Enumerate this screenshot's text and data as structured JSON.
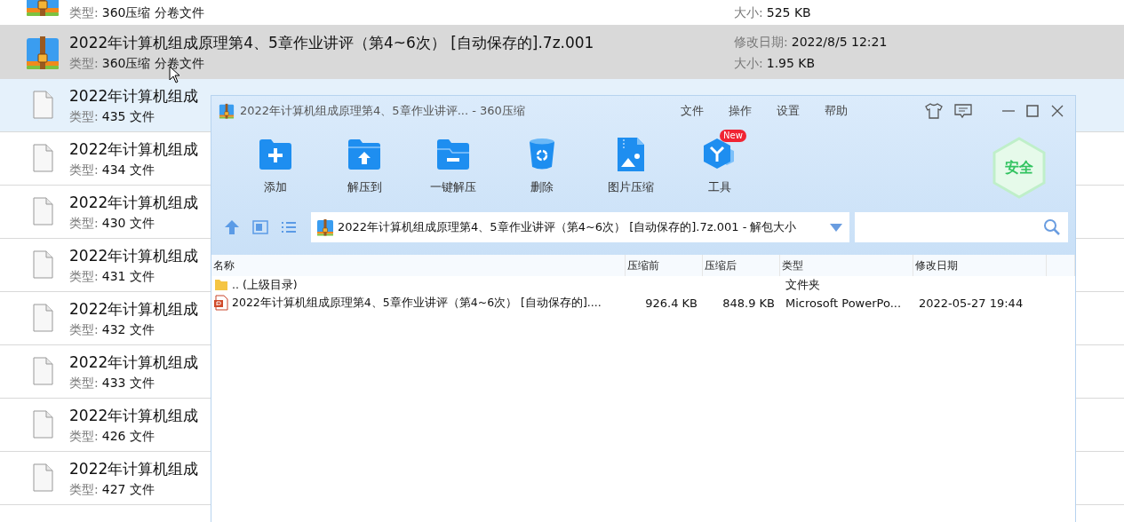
{
  "explorer": {
    "rows": [
      {
        "kind": "partial",
        "selected": false,
        "hovered": false,
        "type": {
          "label": "类型:",
          "value": "360压缩 分卷文件"
        },
        "size": {
          "label": "大小:",
          "value": "525 KB"
        }
      },
      {
        "kind": "archive",
        "selected": true,
        "hovered": false,
        "title": "2022年计算机组成原理第4、5章作业讲评（第4~6次） [自动保存的].7z.001",
        "type": {
          "label": "类型:",
          "value": "360压缩 分卷文件"
        },
        "modified": {
          "label": "修改日期:",
          "value": "2022/8/5 12:21"
        },
        "size": {
          "label": "大小:",
          "value": "1.95 KB"
        }
      },
      {
        "kind": "file",
        "selected": false,
        "hovered": true,
        "title": "2022年计算机组成",
        "type": {
          "label": "类型:",
          "value": "435 文件"
        }
      },
      {
        "kind": "file",
        "selected": false,
        "hovered": false,
        "title": "2022年计算机组成",
        "type": {
          "label": "类型:",
          "value": "434 文件"
        }
      },
      {
        "kind": "file",
        "selected": false,
        "hovered": false,
        "title": "2022年计算机组成",
        "type": {
          "label": "类型:",
          "value": "430 文件"
        }
      },
      {
        "kind": "file",
        "selected": false,
        "hovered": false,
        "title": "2022年计算机组成",
        "type": {
          "label": "类型:",
          "value": "431 文件"
        }
      },
      {
        "kind": "file",
        "selected": false,
        "hovered": false,
        "title": "2022年计算机组成",
        "type": {
          "label": "类型:",
          "value": "432 文件"
        }
      },
      {
        "kind": "file",
        "selected": false,
        "hovered": false,
        "title": "2022年计算机组成",
        "type": {
          "label": "类型:",
          "value": "433 文件"
        }
      },
      {
        "kind": "file",
        "selected": false,
        "hovered": false,
        "title": "2022年计算机组成",
        "type": {
          "label": "类型:",
          "value": "426 文件"
        }
      },
      {
        "kind": "file",
        "selected": false,
        "hovered": false,
        "title": "2022年计算机组成",
        "type": {
          "label": "类型:",
          "value": "427 文件"
        }
      }
    ]
  },
  "archive_window": {
    "title": "2022年计算机组成原理第4、5章作业讲评... - 360压缩",
    "menu": [
      "文件",
      "操作",
      "设置",
      "帮助"
    ],
    "toolbar": [
      {
        "kind": "add",
        "label": "添加"
      },
      {
        "kind": "extract",
        "label": "解压到"
      },
      {
        "kind": "oneclick",
        "label": "一键解压"
      },
      {
        "kind": "delete",
        "label": "删除"
      },
      {
        "kind": "image",
        "label": "图片压缩"
      },
      {
        "kind": "tools",
        "label": "工具",
        "badge": "New"
      }
    ],
    "security_badge": "安全",
    "address": "2022年计算机组成原理第4、5章作业讲评（第4~6次） [自动保存的].7z.001 - 解包大小",
    "columns": [
      "名称",
      "压缩前",
      "压缩后",
      "类型",
      "修改日期"
    ],
    "files": [
      {
        "kind": "folder",
        "name": ".. (上级目录)",
        "type": "文件夹"
      },
      {
        "kind": "ppt",
        "name": "2022年计算机组成原理第4、5章作业讲评（第4~6次） [自动保存的]....",
        "original_size": "926.4 KB",
        "packed_size": "848.9 KB",
        "type": "Microsoft PowerPo...",
        "modified": "2022-05-27 19:44"
      }
    ]
  }
}
